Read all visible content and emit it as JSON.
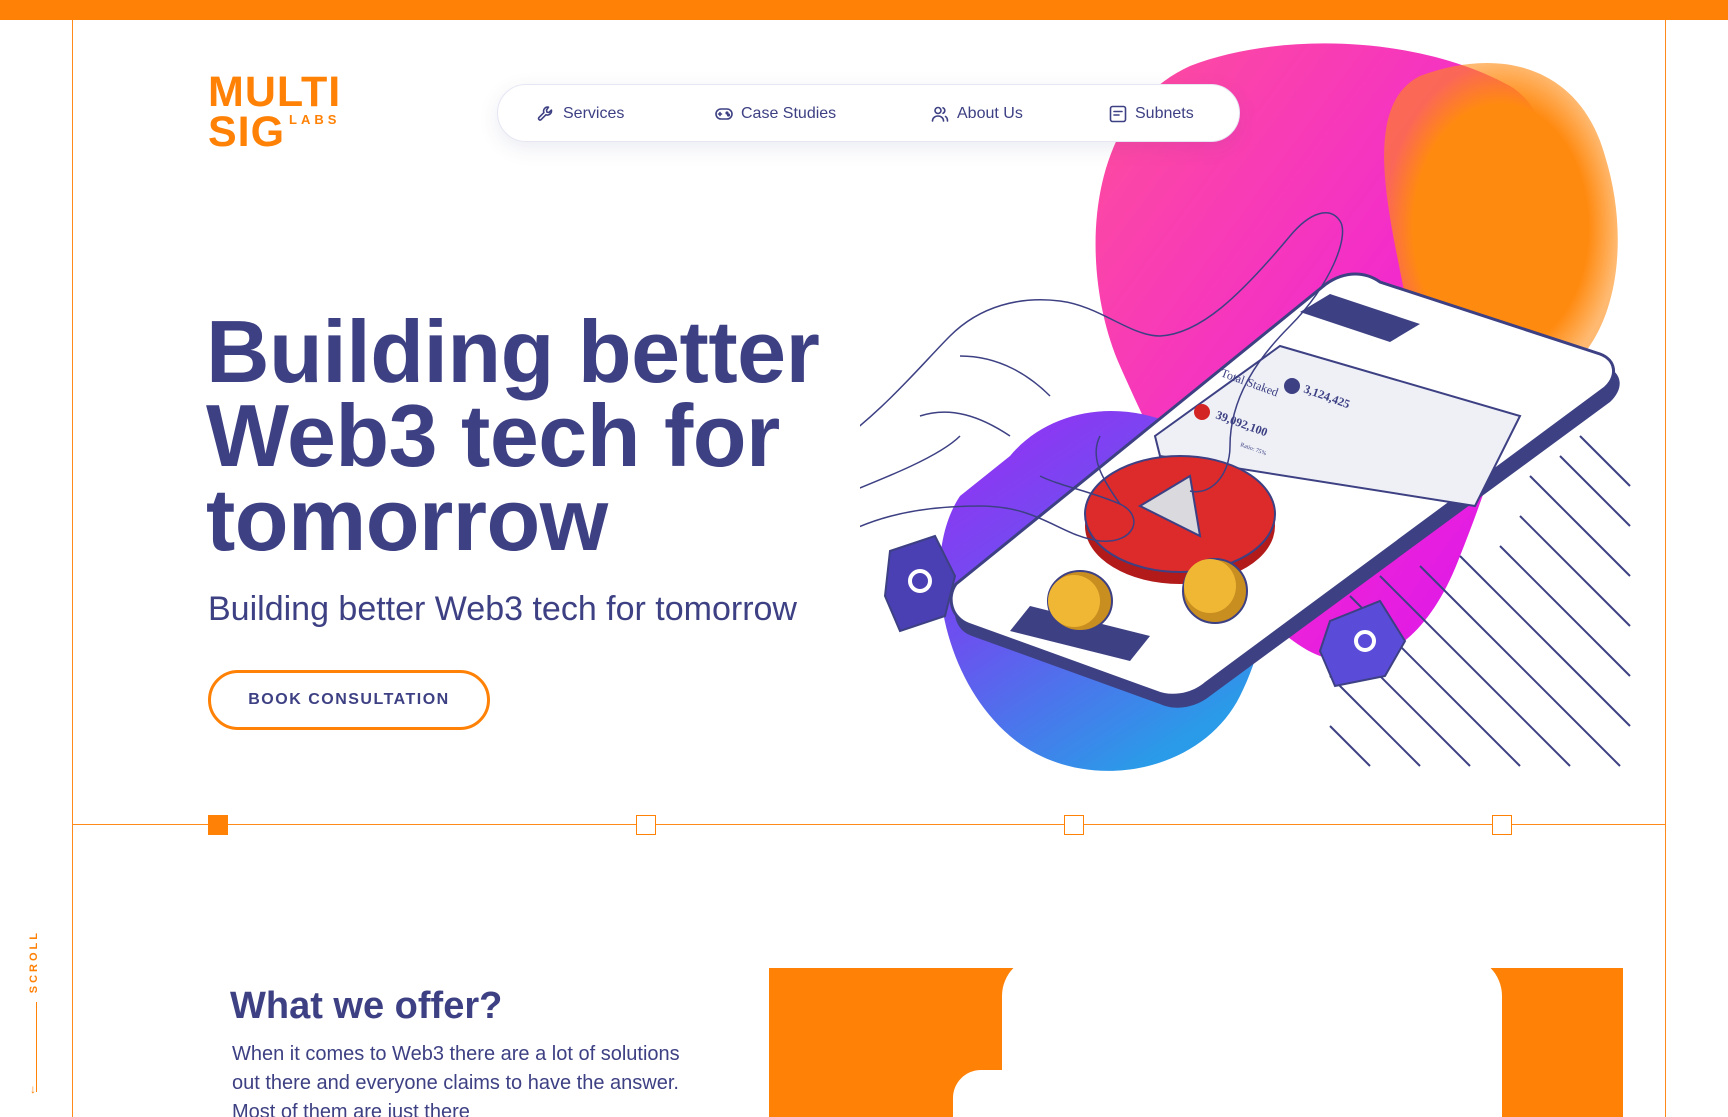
{
  "brand": {
    "logo_line1": "MULTI",
    "logo_line2": "SIG",
    "logo_line3": "LABS",
    "accent": "#ff8106",
    "primary": "#3d4083"
  },
  "nav": {
    "items": [
      {
        "label": "Services",
        "icon": "wrench-icon"
      },
      {
        "label": "Case Studies",
        "icon": "gamepad-icon"
      },
      {
        "label": "About Us",
        "icon": "users-icon"
      },
      {
        "label": "Subnets",
        "icon": "message-icon"
      }
    ]
  },
  "hero": {
    "title": "Building better Web3 tech for tomorrow",
    "subtitle": "Building better Web3 tech for tomorrow",
    "cta_label": "BOOK CONSULTATION",
    "phone_card": {
      "heading": "Total Staked",
      "value_a": "39,092,100",
      "value_b": "3,124,425",
      "footer": "Ratio: 75%"
    }
  },
  "slider": {
    "steps": 4,
    "active_index": 0
  },
  "scroll": {
    "label": "SCROLL"
  },
  "offer": {
    "title": "What we offer?",
    "text": "When it comes to Web3 there are a lot of solutions out there and everyone claims to have the answer. Most of them are just there"
  }
}
